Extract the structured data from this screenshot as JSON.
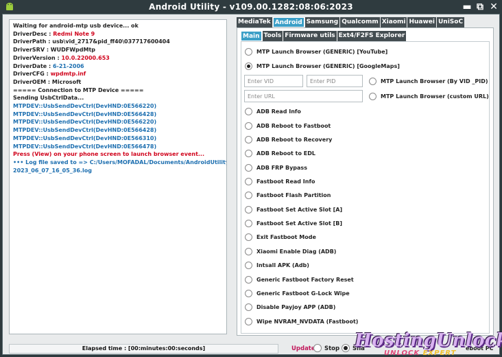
{
  "window": {
    "title": "Android Utility - v109.00.1282:08:06:2023",
    "minimize_glyph": "▬",
    "restore_glyph": "⧉",
    "close_glyph": "✕"
  },
  "log": {
    "line1": "Waiting for android-mtp usb device... ok",
    "desc_k": "DriverDesc : ",
    "desc_v": "Redmi Note 9",
    "path_k": "DriverPath : ",
    "path_v": "usb\\vid_2717&pid_ff40\\037717600404",
    "srv_k": "DriverSRV : ",
    "srv_v": "WUDFWpdMtp",
    "ver_k": "DriverVersion : ",
    "ver_v": "10.0.22000.653",
    "date_k": "DriverDate : ",
    "date_v": "6-21-2006",
    "cfg_k": "DriverCFG : ",
    "cfg_v": "wpdmtp.inf",
    "oem_k": "DriverOEM : ",
    "oem_v": "Microsoft",
    "conn": "===== Connection to MTP Device =====",
    "sending": "Sending UsbCtrlData...",
    "mtp": [
      "MTPDEV::UsbSendDevCtrl(DevHND:0E566220)",
      "MTPDEV::UsbSendDevCtrl(DevHND:0E566428)",
      "MTPDEV::UsbSendDevCtrl(DevHND:0E566220)",
      "MTPDEV::UsbSendDevCtrl(DevHND:0E566428)",
      "MTPDEV::UsbSendDevCtrl(DevHND:0E566310)",
      "MTPDEV::UsbSendDevCtrl(DevHND:0E566478)"
    ],
    "press": "Press (View) on your phone screen to launch browser event...",
    "saved_prefix": "••• Log file saved to => ",
    "saved_path": "C:/Users/MOFADAL/Documents/AndroidUtility/Logs/",
    "saved_file": "2023_06_07_16_05_36.log"
  },
  "tabs": [
    "MediaTek",
    "Android",
    "Samsung",
    "Qualcomm",
    "Xiaomi",
    "Huawei",
    "UniSoC"
  ],
  "subtabs": [
    "Main",
    "Tools",
    "Firmware utils",
    "Ext4/F2FS Explorer"
  ],
  "options": {
    "mtp_youtube": "MTP Launch Browser (GENERIC) [YouTube]",
    "mtp_maps": "MTP Launch Browser (GENERIC) [GoogleMaps]",
    "vid_placeholder": "Enter VID",
    "pid_placeholder": "Enter PID",
    "mtp_vidpid": "MTP Launch Browser (By VID _PID)",
    "url_placeholder": "Enter URL",
    "mtp_custom": "MTP Launch Browser (custom URL)",
    "list": [
      "ADB Read Info",
      "ADB Reboot to Fastboot",
      "ADB Reboot to Recovery",
      "ADB Reboot to EDL",
      "ADB FRP Bypass",
      "Fastboot Read Info",
      "Fastboot Flash Partition",
      "Fastboot Set Active Slot [A]",
      "Fastboot Set Active Slot [B]",
      "Exit Fastboot Mode",
      "Xiaomi Enable Diag (ADB)",
      "Intsall APK (Adb)",
      "Generic Fastboot Factory Reset",
      "Generic Fastboot G-Lock Wipe",
      "Disable Payjoy APP (ADB)",
      "Wipe NVRAM_NVDATA (Fastboot)"
    ]
  },
  "status": {
    "elapsed": "Elapsed time : [00:minutes:00:seconds]",
    "update": "Update",
    "stop": "Stop",
    "snap": "Sna",
    "reboot_pc": "eboot PC"
  },
  "watermark": {
    "main": "HostingUnlock",
    "sub_a": "UNLOCK",
    "sub_b": "EXPERT"
  },
  "colors": {
    "title_bg": "#2f3b3f",
    "tab_active": "#3c9fc7",
    "tab_inactive": "#444d51",
    "log_red": "#d0021b",
    "log_blue": "#1d6fb0"
  }
}
